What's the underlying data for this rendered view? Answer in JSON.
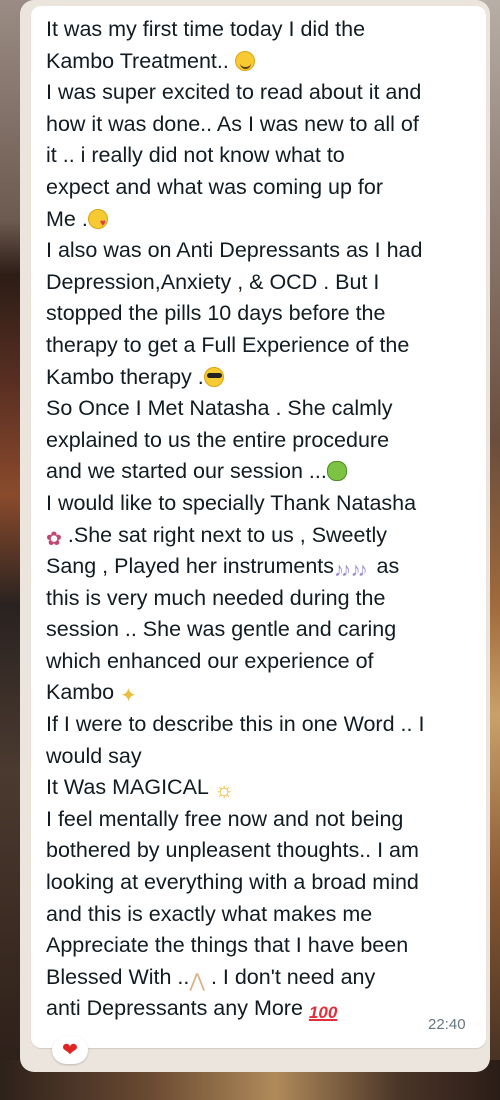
{
  "message": {
    "lines": [
      "It was my first time today I did the",
      "Kambo Treatment.. ",
      "I was super excited to read about it and",
      "how it was done.. As I was new to all of",
      "it .. i really  did not know what to",
      "expect and what was coming up for",
      "Me .",
      " I also was on Anti Depressants as I had",
      "Depression,Anxiety , & OCD . But I",
      "stopped the pills 10 days   before the",
      "therapy  to  get a Full Experience of the",
      "Kambo therapy .",
      "So Once I Met Natasha . She calmly",
      "explained to us the entire procedure",
      "and we started our session ...",
      " I would like to specially Thank Natasha",
      " .She sat right next to us , Sweetly",
      "Sang , Played her instruments",
      "this is very much needed during the",
      "session .. She was gentle and caring",
      "which enhanced our experience of",
      "Kambo ",
      "If I were to describe this in one Word .. I",
      "would say",
      "It Was  MAGICAL ",
      "I feel mentally free now and not being",
      "bothered by unpleasent thoughts.. I am",
      "looking at everything with a broad mind",
      "and this is exactly what makes me",
      "Appreciate the things that I have been",
      "Blessed With ..",
      " . I don't need any",
      "anti Depressants any More "
    ],
    "time": "22:40",
    "hundred_emoji": "100",
    "music_emoji": "♪♪ ♪♪",
    "reaction": "❤"
  }
}
